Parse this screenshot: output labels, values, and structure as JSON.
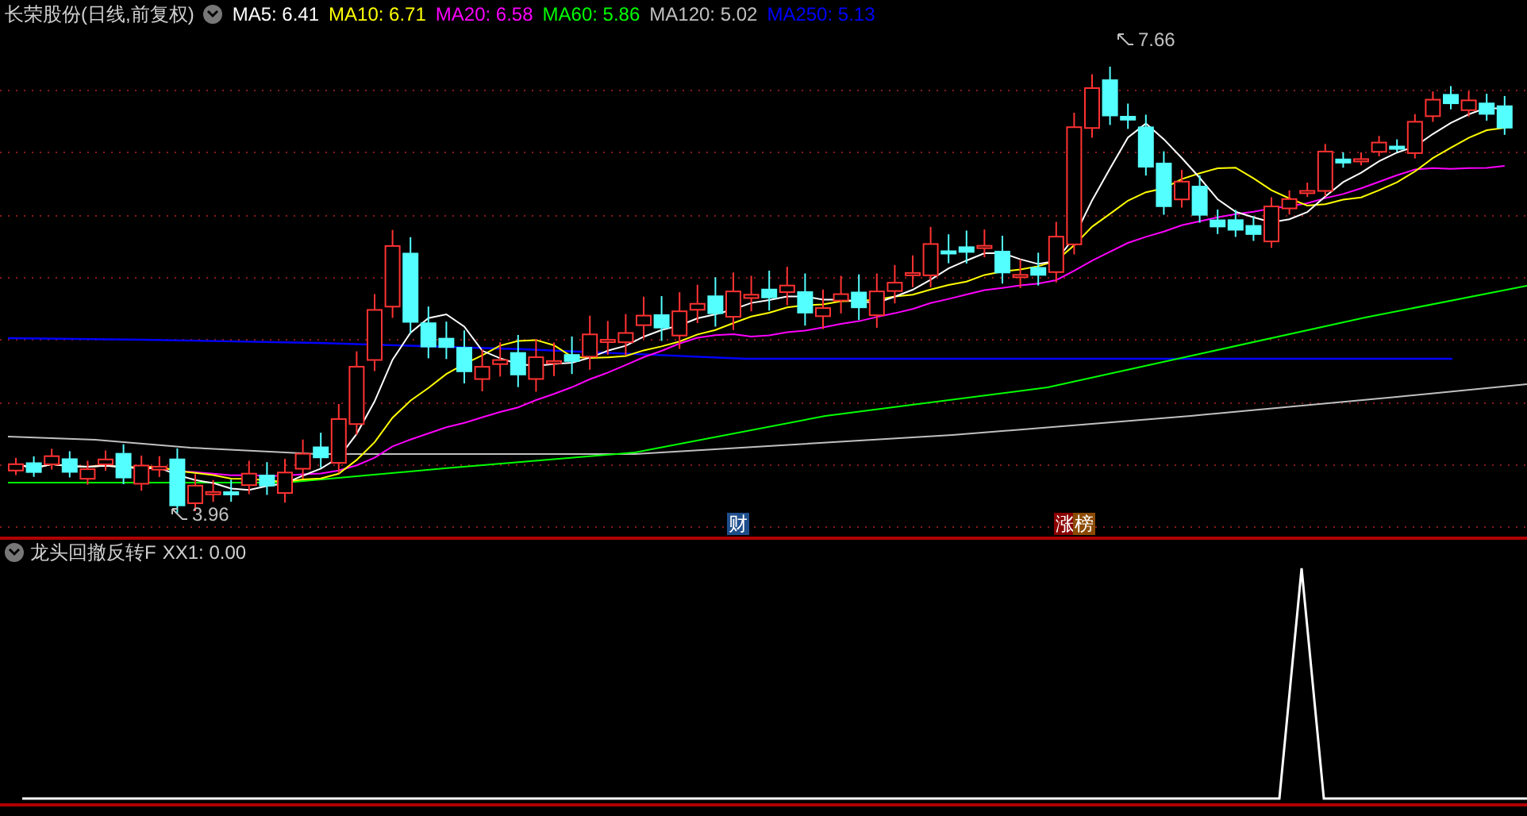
{
  "header": {
    "title": "长荣股份(日线,前复权)",
    "moving_averages": [
      {
        "label": "MA5: 6.41",
        "color": "#ffffff"
      },
      {
        "label": "MA10: 6.71",
        "color": "#ffff00"
      },
      {
        "label": "MA20: 6.58",
        "color": "#ff00ff"
      },
      {
        "label": "MA60: 5.86",
        "color": "#00ff00"
      },
      {
        "label": "MA120: 5.02",
        "color": "#c0c0c0"
      },
      {
        "label": "MA250: 5.13",
        "color": "#0000ff"
      }
    ]
  },
  "price_chart": {
    "high_label": "7.66",
    "low_label": "3.96",
    "events": [
      {
        "label": "财",
        "color": "#1f4e8c"
      },
      {
        "label": "涨",
        "color": "#8b0000"
      },
      {
        "label": "榜",
        "color": "#8b4a00"
      }
    ]
  },
  "indicator": {
    "name": "龙头回撤反转F",
    "reading": "XX1: 0.00"
  }
}
